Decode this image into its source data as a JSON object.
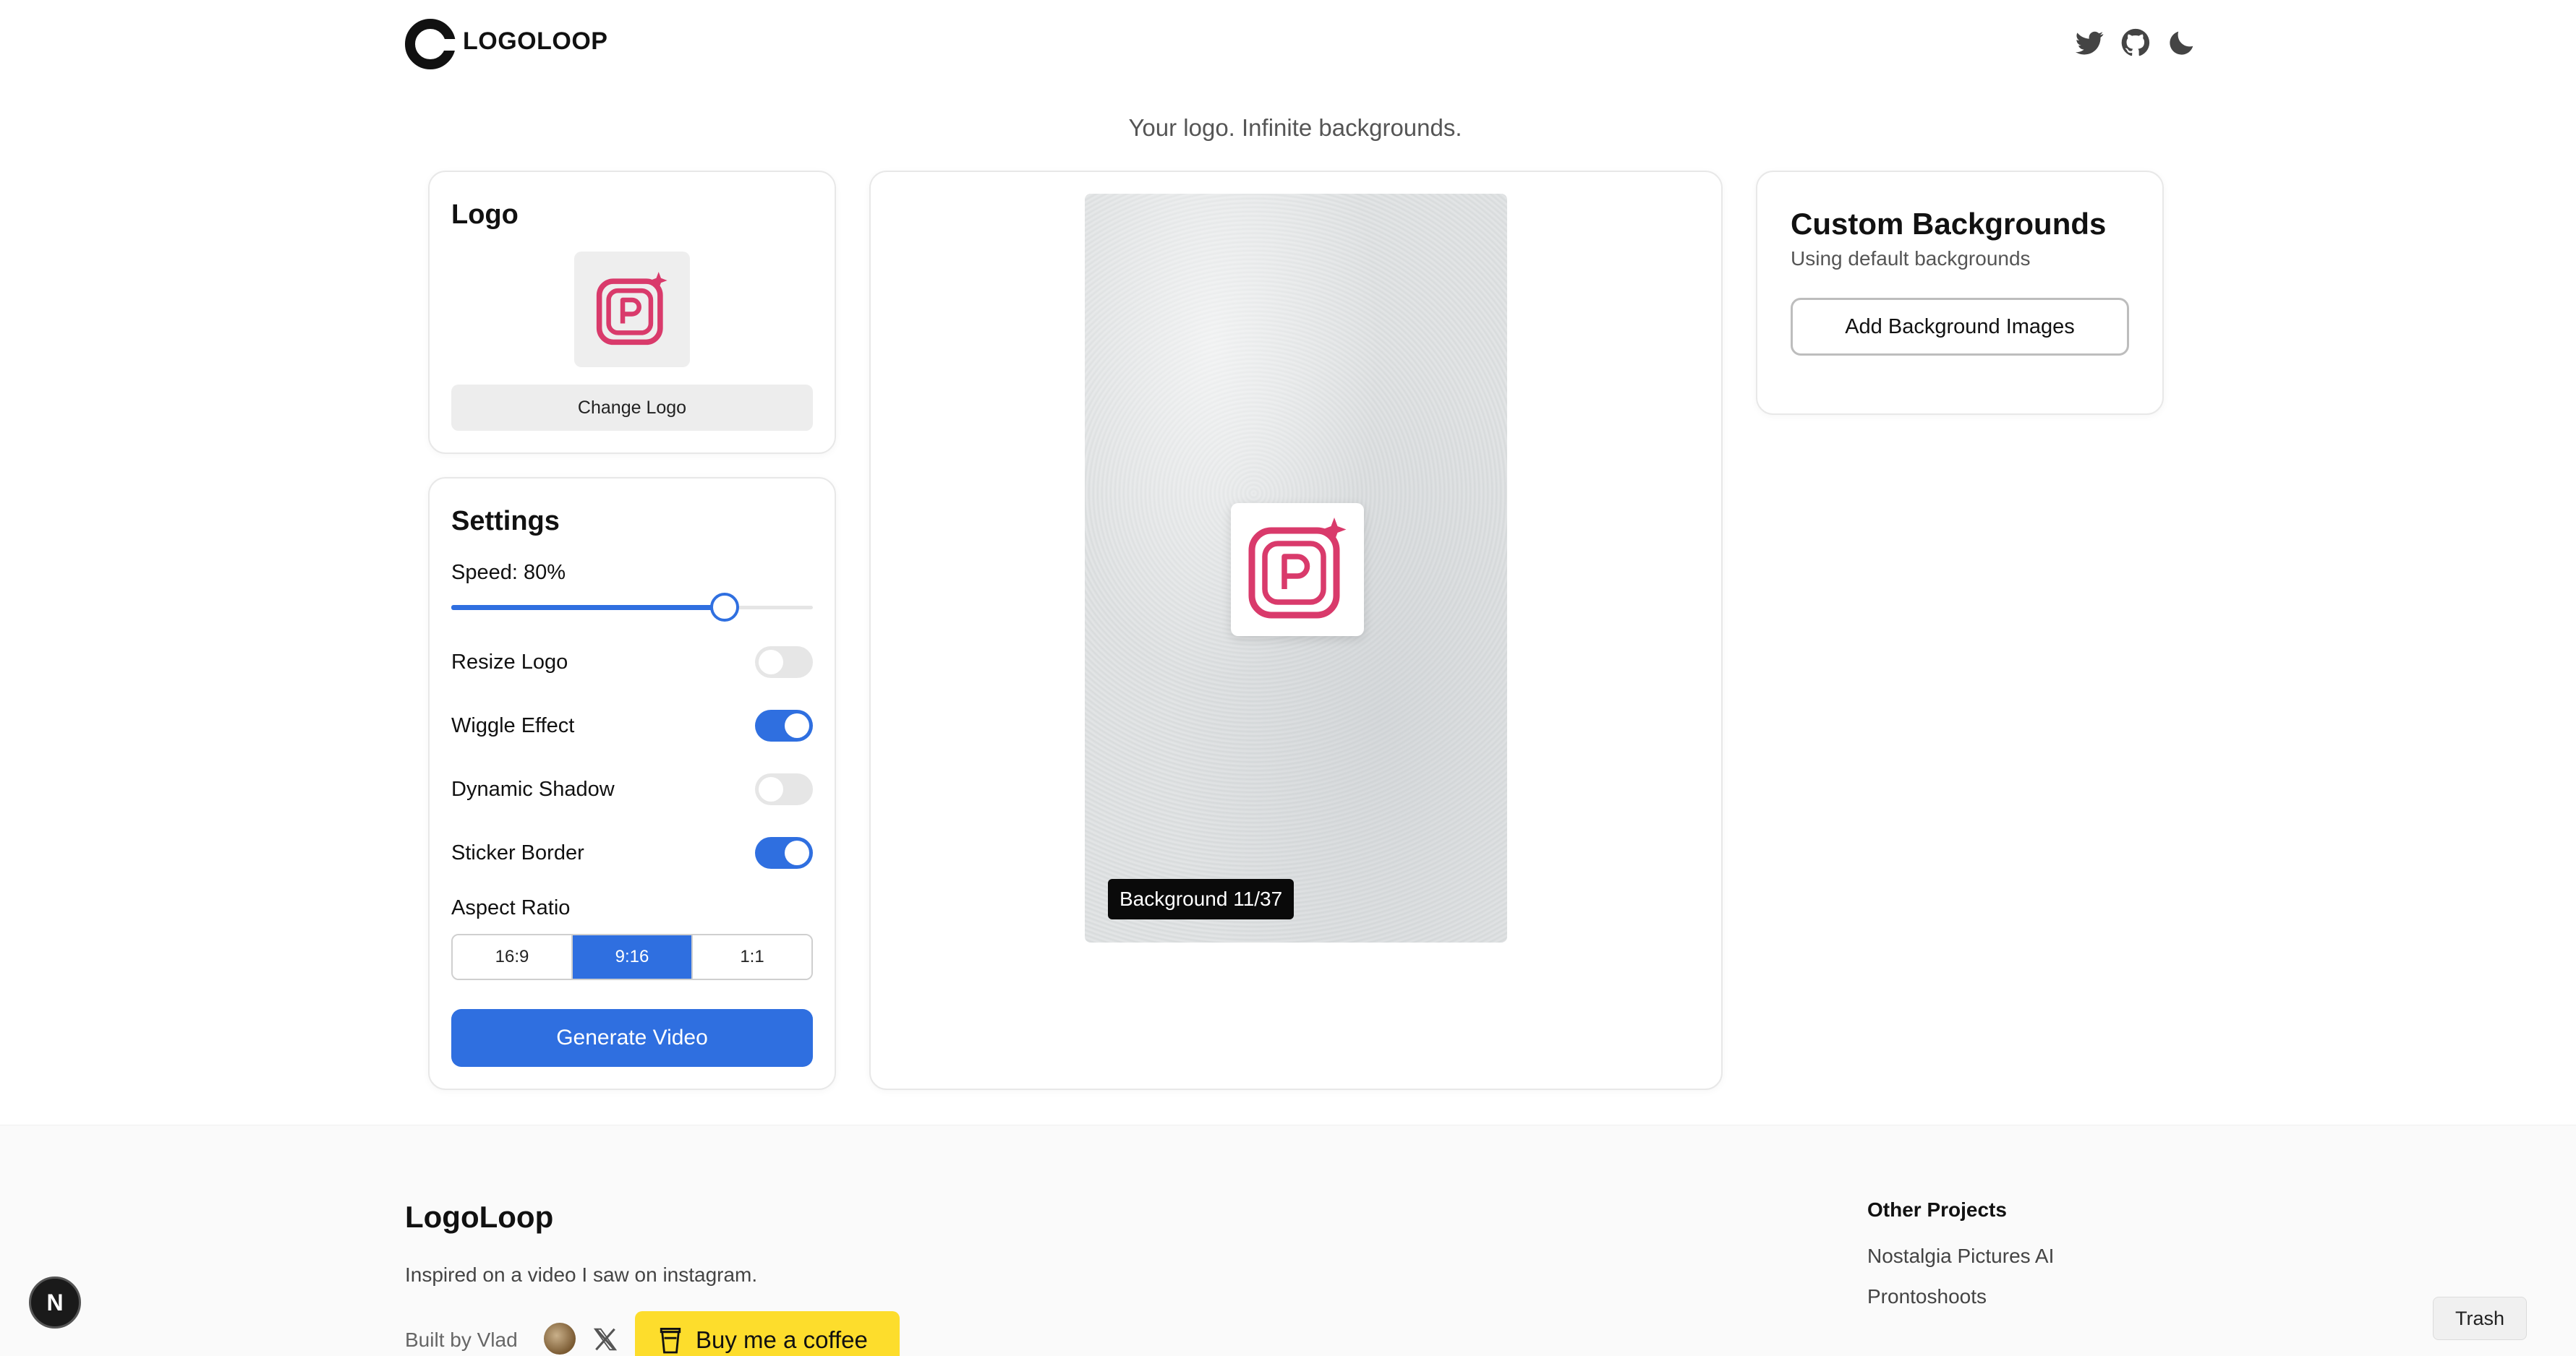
{
  "header": {
    "brand": "LOGOLOOP",
    "icons": [
      "twitter-icon",
      "github-icon",
      "moon-icon"
    ],
    "tagline": "Your logo. Infinite backgrounds."
  },
  "logo_card": {
    "title": "Logo",
    "change_label": "Change Logo"
  },
  "settings": {
    "title": "Settings",
    "speed_label": "Speed: 80%",
    "speed_value": 0.8,
    "toggles": [
      {
        "label": "Resize Logo",
        "on": false
      },
      {
        "label": "Wiggle Effect",
        "on": true
      },
      {
        "label": "Dynamic Shadow",
        "on": false
      },
      {
        "label": "Sticker Border",
        "on": true
      }
    ],
    "aspect_label": "Aspect Ratio",
    "ratios": [
      "16:9",
      "9:16",
      "1:1"
    ],
    "selected_ratio": "9:16",
    "generate_label": "Generate Video"
  },
  "preview": {
    "badge": "Background 11/37"
  },
  "custom": {
    "title": "Custom Backgrounds",
    "subtitle": "Using default backgrounds",
    "add_label": "Add Background Images"
  },
  "footer": {
    "brand": "LogoLoop",
    "desc": "Inspired on a video I saw on instagram.",
    "built_by": "Built by Vlad",
    "coffee": "Buy me a coffee",
    "other_title": "Other Projects",
    "other_links": [
      "Nostalgia Pictures AI",
      "Prontoshoots"
    ]
  },
  "overlay": {
    "next_badge": "N",
    "trash_tip": "Trash"
  },
  "colors": {
    "accent": "#2f6fe0",
    "logo_pink": "#d93a6b",
    "coffee_yellow": "#fddd2c"
  }
}
